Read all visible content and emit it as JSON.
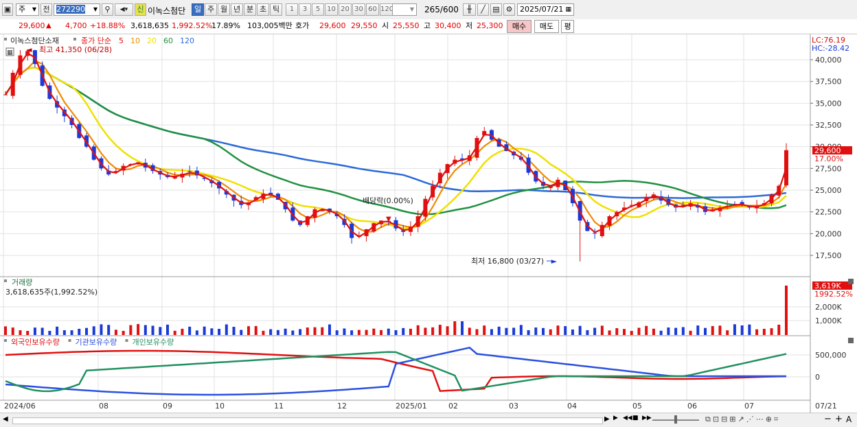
{
  "toolbar": {
    "market_label": "주",
    "scope_label": "전",
    "code": "272290",
    "stock_name": "이녹스첨단",
    "new_badge": "신",
    "periods": [
      "일",
      "주",
      "월",
      "년",
      "분",
      "초",
      "틱"
    ],
    "selected_period": "일",
    "minute_steps": [
      "1",
      "3",
      "5",
      "10",
      "20",
      "30",
      "60",
      "120"
    ],
    "count_value": "265",
    "count_total": "/600",
    "date": "2025/07/21"
  },
  "quote": {
    "price": "29,600",
    "change_arrow": "▲",
    "change": "4,700",
    "change_pct": "+18.88%",
    "volume": "3,618,635",
    "volume_pct": "1,992.52%",
    "turnover": "17.89%",
    "amount": "103,005백만",
    "ask_label": "호가",
    "ask": "29,600",
    "bid": "29,550",
    "open_label": "시",
    "open": "25,550",
    "high_label": "고",
    "high": "30,400",
    "low_label": "저",
    "low": "25,300",
    "buy_label": "매수",
    "sell_label": "매도",
    "eval_label": "평"
  },
  "price_panel": {
    "title": "이녹스첨단소재",
    "legend_prefix": "종가 단순",
    "ma": [
      {
        "label": "5",
        "color": "#e01010"
      },
      {
        "label": "10",
        "color": "#f08a00"
      },
      {
        "label": "20",
        "color": "#f0e000"
      },
      {
        "label": "60",
        "color": "#209040"
      },
      {
        "label": "120",
        "color": "#2a6ad8"
      }
    ],
    "high_note": "최고 41,350 (06/28)",
    "low_note": "최저 16,800 (03/27)",
    "dividend_note": "배당락(0.00%)",
    "lc": "LC:76.19",
    "hc": "HC:-28.42",
    "last_price": "29,600",
    "last_pct": "17.00%",
    "y_ticks": [
      "40,000",
      "37,500",
      "35,000",
      "32,500",
      "30,000",
      "27,500",
      "25,000",
      "22,500",
      "20,000",
      "17,500"
    ],
    "y_values": [
      40000,
      37500,
      35000,
      32500,
      30000,
      27500,
      25000,
      22500,
      20000,
      17500
    ],
    "up_color": "#e01010",
    "down_color": "#1a3ad8"
  },
  "volume_panel": {
    "title": "거래량",
    "value": "3,618,635주(1,992.52%)",
    "y_ticks": [
      "2,000K",
      "1,000K"
    ],
    "last": "3,619K",
    "last_pct": "1992.52%"
  },
  "holder_panel": {
    "legend": [
      {
        "label": "외국인보유수량",
        "color": "#e01010"
      },
      {
        "label": "기관보유수량",
        "color": "#2a50e0"
      },
      {
        "label": "개인보유수량",
        "color": "#209060"
      }
    ],
    "y_ticks": [
      "500,000",
      "0"
    ]
  },
  "x_axis": {
    "labels": [
      "2024/06",
      "08",
      "09",
      "10",
      "11",
      "12",
      "2025/01",
      "02",
      "03",
      "04",
      "05",
      "06",
      "07"
    ],
    "right_label": "07/21"
  },
  "chart_data": {
    "type": "candlestick",
    "period": "daily",
    "price_high": {
      "value": 41350,
      "date": "06/28"
    },
    "price_low": {
      "value": 16800,
      "date": "03/27"
    },
    "close_last": 29600,
    "ohlc_last": {
      "open": 25550,
      "high": 30400,
      "low": 25300,
      "close": 29600
    },
    "volume_last": 3618635,
    "y_range": [
      15500,
      42000
    ],
    "close_series": [
      36000,
      38500,
      40500,
      41000,
      39500,
      37000,
      35500,
      34500,
      33500,
      32500,
      31000,
      30000,
      28500,
      27500,
      26800,
      27200,
      27800,
      28000,
      28200,
      27600,
      27200,
      26800,
      26500,
      26600,
      26900,
      27100,
      26700,
      26300,
      25800,
      25200,
      24500,
      23800,
      23300,
      23600,
      24200,
      24600,
      24400,
      23900,
      22800,
      21500,
      21000,
      22000,
      22800,
      22800,
      22500,
      22000,
      21000,
      19500,
      19800,
      20500,
      21200,
      21500,
      21300,
      20600,
      20200,
      20800,
      22000,
      24000,
      25500,
      27000,
      28000,
      28500,
      28400,
      29000,
      31000,
      31800,
      30800,
      30000,
      29500,
      29000,
      28500,
      27000,
      26000,
      25500,
      25500,
      26200,
      25000,
      23500,
      21500,
      20300,
      20000,
      21000,
      22000,
      22500,
      23000,
      23300,
      23600,
      24200,
      24500,
      23800,
      23300,
      23000,
      23200,
      23500,
      23000,
      22500,
      22800,
      23000,
      23200,
      23400,
      23300,
      23000,
      23200,
      23500,
      24500,
      25500,
      29600
    ],
    "ma_series_present": [
      "5",
      "10",
      "20",
      "60",
      "120"
    ]
  },
  "bottom": {
    "icons": [
      "play-icon",
      "rewind-icon",
      "stop-icon",
      "fast-forward-icon"
    ],
    "zoom_minus": "−",
    "zoom_plus": "+",
    "auto": "A"
  }
}
